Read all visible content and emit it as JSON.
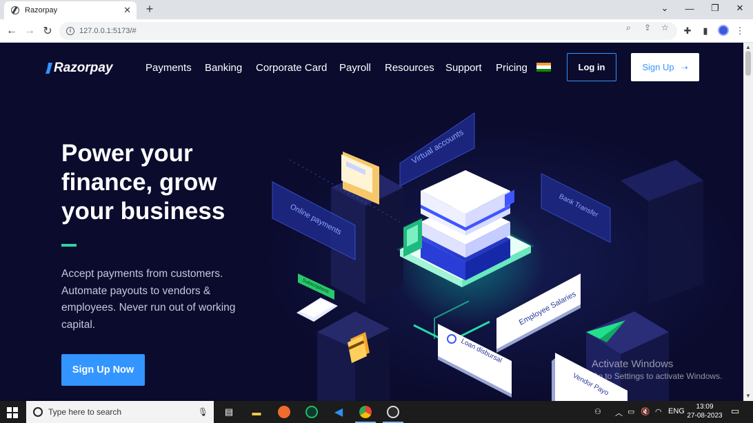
{
  "browser": {
    "tab_title": "Razorpay",
    "url": "127.0.0.1:5173/#"
  },
  "header": {
    "logo_text": "Razorpay",
    "nav": [
      "Payments",
      "Banking",
      "Corporate Card",
      "Payroll",
      "Resources",
      "Support",
      "Pricing"
    ],
    "login_label": "Log in",
    "signup_label": "Sign Up"
  },
  "hero": {
    "title_lines": [
      "Power your",
      "finance, grow",
      "your business"
    ],
    "subtitle": "Accept payments from customers. Automate payouts to vendors & employees. Never run out of working capital.",
    "cta_label": "Sign Up Now"
  },
  "illustration": {
    "labels": {
      "virtual_accounts": "Virtual accounts",
      "online_payments": "Online payments",
      "bank_transfer": "Bank Transfer",
      "subscriptions": "Subscriptions",
      "employee_salaries": "Employee Salaries",
      "loan_disbursal": "Loan disbursal",
      "vendor_payouts": "Vendor Payo"
    }
  },
  "watermark": {
    "title": "Activate Windows",
    "subtitle": "Go to Settings to activate Windows."
  },
  "taskbar": {
    "search_placeholder": "Type here to search",
    "language": "ENG",
    "time": "13:09",
    "date": "27-08-2023"
  },
  "colors": {
    "page_bg": "#0b0b2e",
    "brand_blue": "#3395ff",
    "accent_green": "#2fd3a0"
  }
}
